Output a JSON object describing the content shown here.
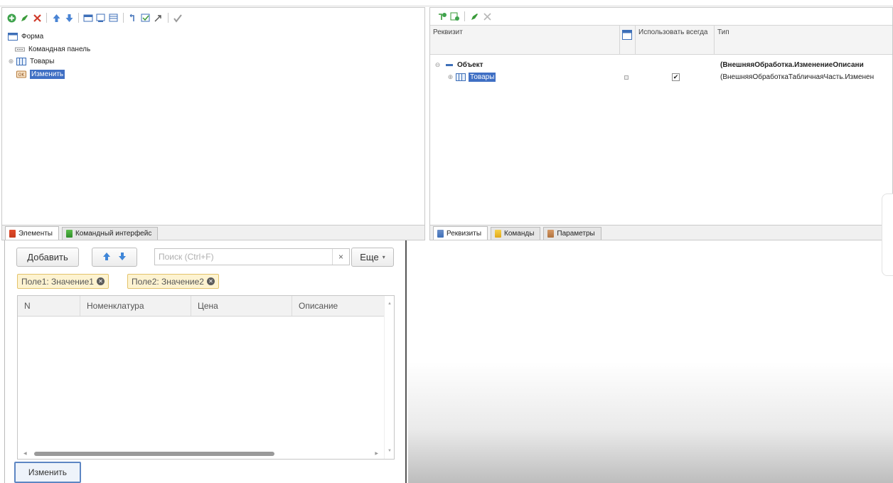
{
  "elements_tree": {
    "items": [
      {
        "label": "Форма",
        "level": 0,
        "icon": "form-icon"
      },
      {
        "label": "Командная панель",
        "level": 1,
        "icon": "command-panel-icon"
      },
      {
        "label": "Товары",
        "level": 0,
        "icon": "table-icon",
        "expander": "⊕"
      },
      {
        "label": "Изменить",
        "level": 1,
        "icon": "button-ok-icon",
        "selected": true
      }
    ],
    "tabs": [
      "Элементы",
      "Командный интерфейс"
    ]
  },
  "attributes": {
    "columns": {
      "rekvizit": "Реквизит",
      "use_always": "Использовать всегда",
      "type": "Тип"
    },
    "rows": [
      {
        "label": "Объект",
        "expander": "⊖",
        "type": "(ВнешняяОбработка.ИзменениеОписани",
        "checked": false
      },
      {
        "label": "Товары",
        "expander": "⊕",
        "type": "(ВнешняяОбработкаТабличнаяЧасть.Изменен",
        "checked": true
      }
    ],
    "tabs": [
      "Реквизиты",
      "Команды",
      "Параметры"
    ]
  },
  "preview": {
    "add_button": "Добавить",
    "search_placeholder": "Поиск (Ctrl+F)",
    "search_clear": "×",
    "more_button": "Еще",
    "filters": [
      "Поле1: Значение1",
      "Поле2: Значение2"
    ],
    "columns": [
      "N",
      "Номенклатура",
      "Цена",
      "Описание"
    ],
    "change_button": "Изменить"
  },
  "colors": {
    "selection": "#3f6fc4",
    "chip_bg": "#fdf3d1",
    "chip_border": "#e3c36a",
    "focus_border": "#5d86c3"
  }
}
